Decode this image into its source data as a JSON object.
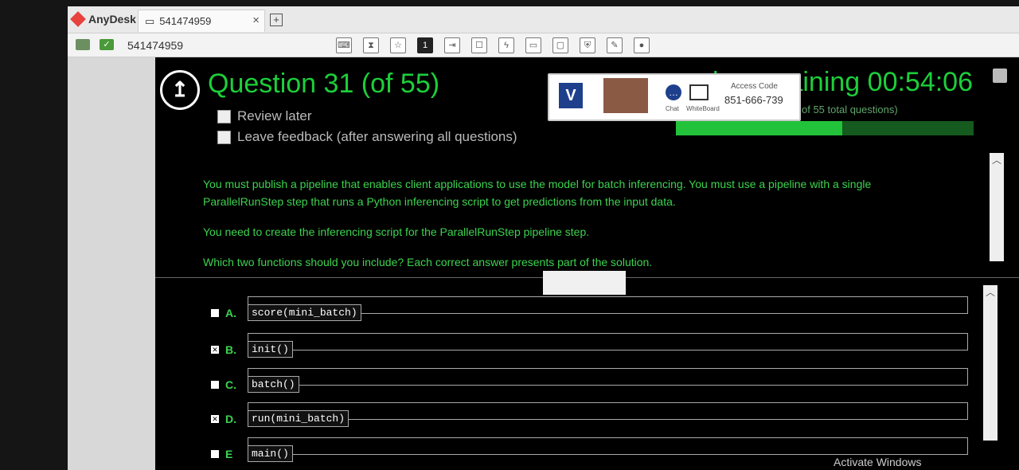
{
  "anydesk": {
    "app_name": "AnyDesk",
    "tab_label": "541474959",
    "toolbar_id": "541474959",
    "toolbar_badge": "1"
  },
  "exam": {
    "title": "Question 31 (of 55)",
    "review_later": "Review later",
    "leave_feedback": "Leave feedback (after answering all questions)",
    "time_remaining": "le remaining 00:54:06",
    "progress_text": "exam progress (31 of 55 total questions)",
    "progress": 0.56,
    "question_p1": "You must publish a pipeline that enables client applications to use the model for batch inferencing. You must use a pipeline with a single ParallelRunStep step that runs a Python inferencing script to get predictions from the input data.",
    "question_p2": "You need to create the inferencing script for the ParallelRunStep pipeline step.",
    "question_p3": "Which two functions should you include? Each correct answer presents part of the solution."
  },
  "overlay": {
    "chat_label": "Chat",
    "whiteboard_label": "WhiteBoard",
    "access_label": "Access Code",
    "access_code": "851-666-739"
  },
  "answers": [
    {
      "letter": "A.",
      "code": "score(mini_batch)",
      "checked": false
    },
    {
      "letter": "B.",
      "code": "init()",
      "checked": true
    },
    {
      "letter": "C.",
      "code": "batch()",
      "checked": false
    },
    {
      "letter": "D.",
      "code": "run(mini_batch)",
      "checked": true
    },
    {
      "letter": "E",
      "code": "main()",
      "checked": false
    }
  ],
  "watermark": "Activate Windows",
  "colors": {
    "accent": "#1ccf3a",
    "text_green": "#3cd34e"
  }
}
